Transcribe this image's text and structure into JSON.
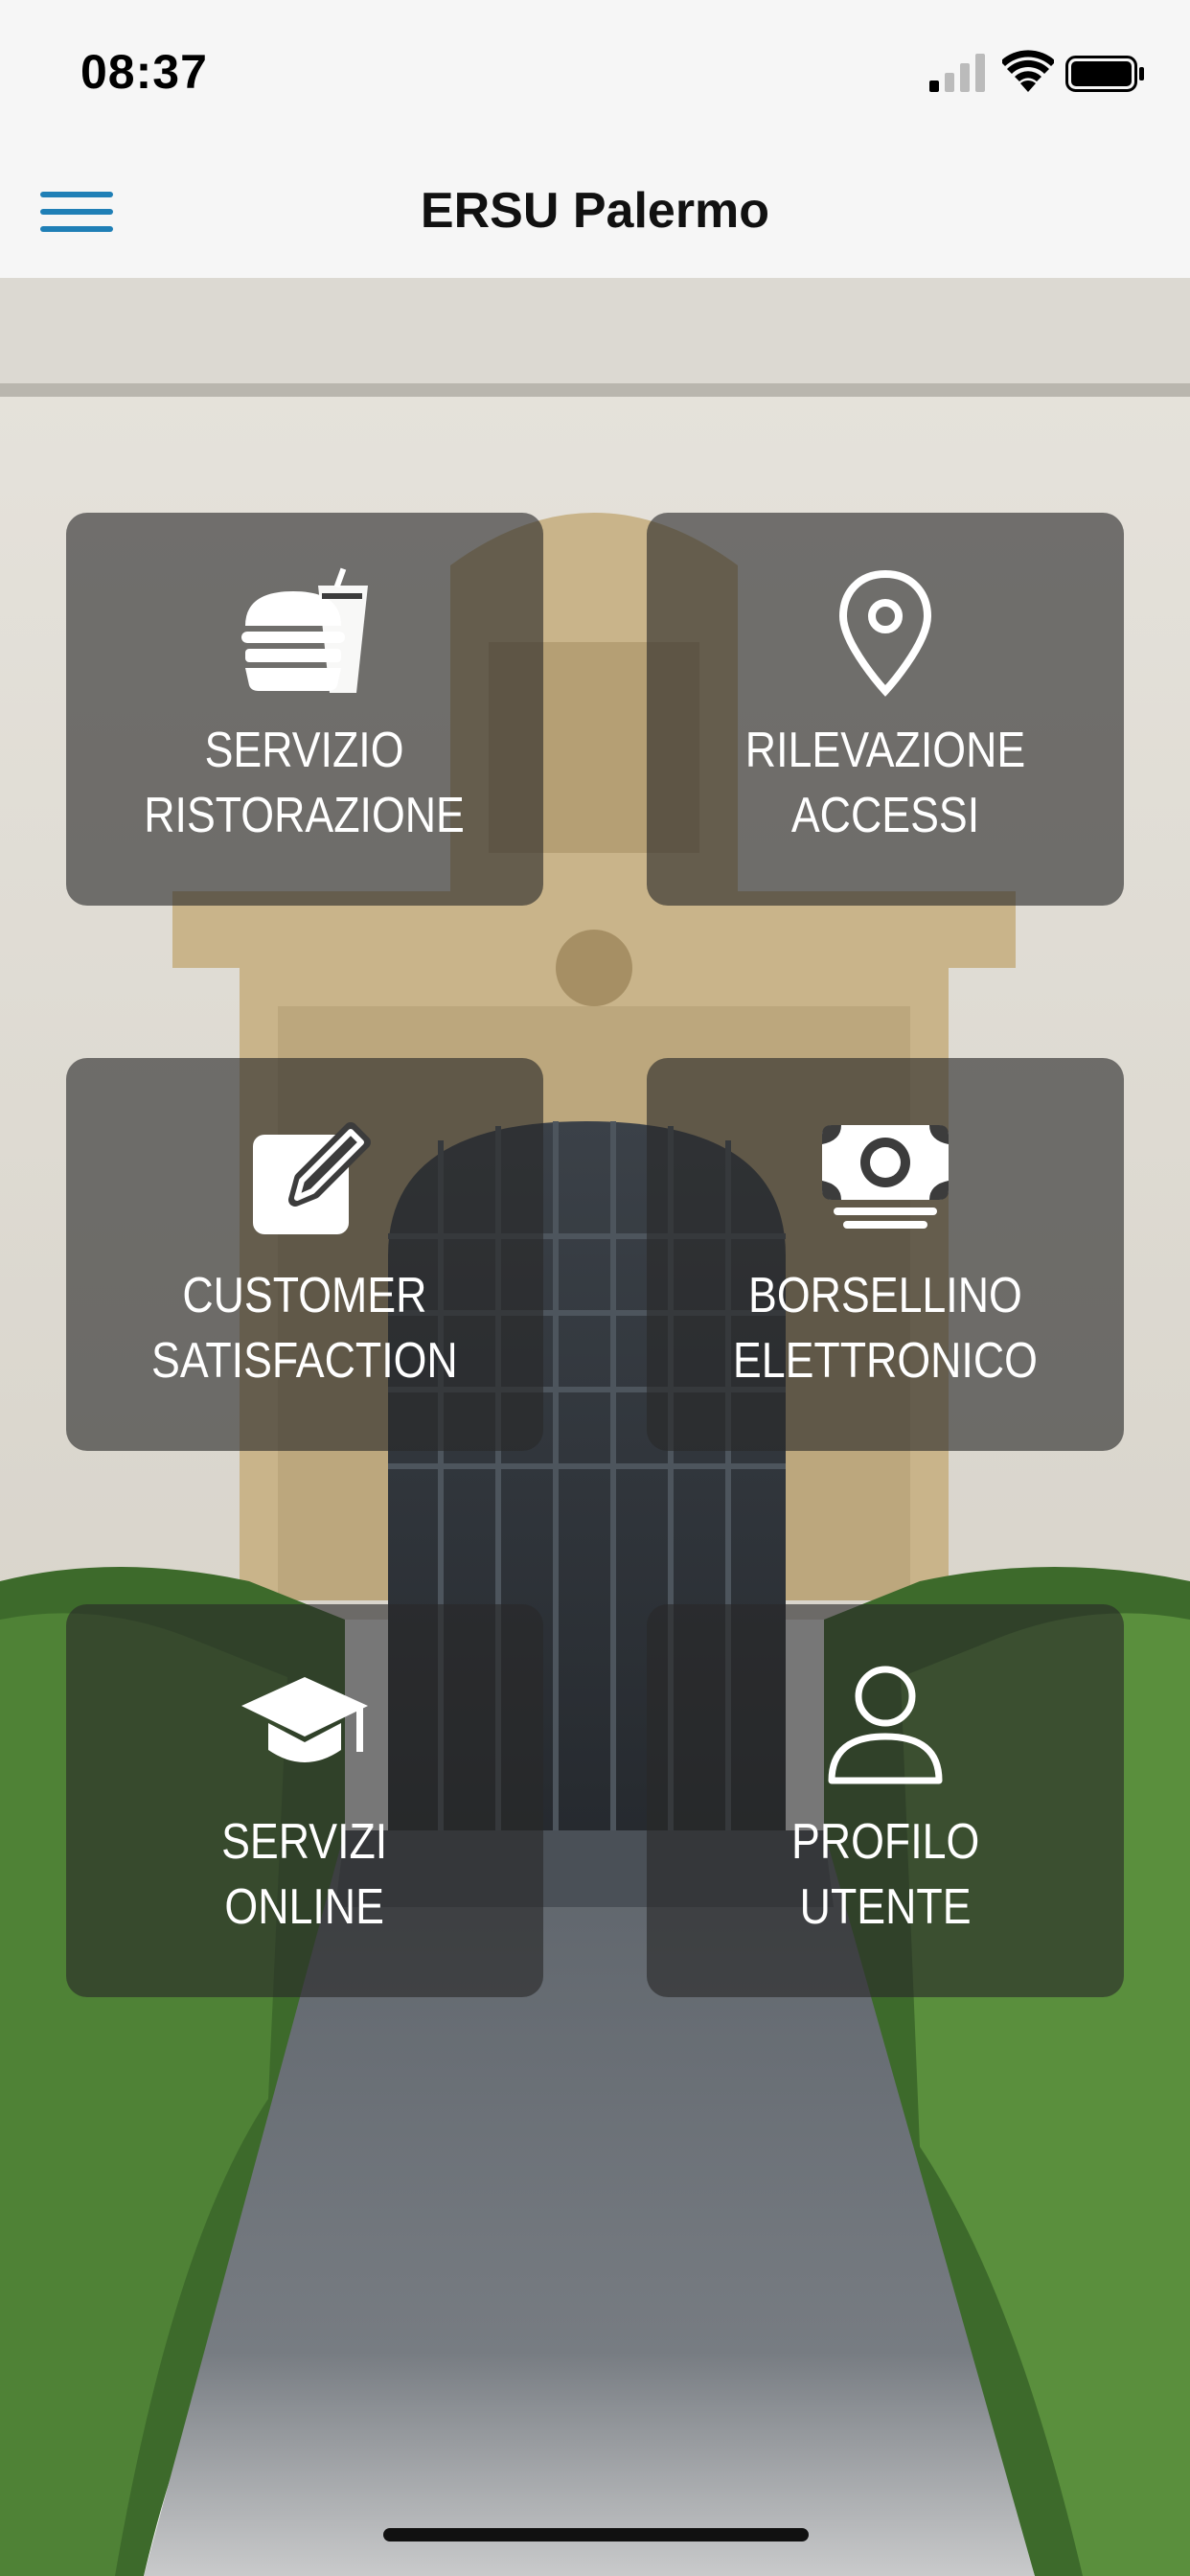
{
  "status_bar": {
    "time": "08:37"
  },
  "navbar": {
    "title": "ERSU Palermo"
  },
  "tiles": [
    {
      "line1": "SERVIZIO",
      "line2": "RISTORAZIONE",
      "icon": "food-icon"
    },
    {
      "line1": "RILEVAZIONE",
      "line2": "ACCESSI",
      "icon": "location-pin-icon"
    },
    {
      "line1": "CUSTOMER",
      "line2": "SATISFACTION",
      "icon": "edit-icon"
    },
    {
      "line1": "BORSELLINO",
      "line2": "ELETTRONICO",
      "icon": "money-icon"
    },
    {
      "line1": "SERVIZI",
      "line2": "ONLINE",
      "icon": "graduation-cap-icon"
    },
    {
      "line1": "PROFILO",
      "line2": "UTENTE",
      "icon": "user-icon"
    }
  ],
  "colors": {
    "accent": "#1f7fb6",
    "tile_bg": "rgba(40,40,40,0.62)"
  }
}
